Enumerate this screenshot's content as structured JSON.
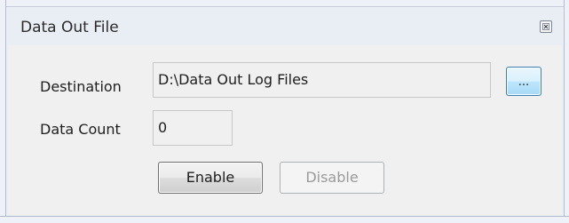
{
  "window": {
    "title": "Data Out File",
    "close_icon": "close-icon"
  },
  "form": {
    "destination_label": "Destination",
    "destination_value": "D:\\Data Out Log Files",
    "browse_label": "...",
    "data_count_label": "Data Count",
    "data_count_value": "0"
  },
  "actions": {
    "enable_label": "Enable",
    "disable_label": "Disable",
    "disable_enabled": false
  },
  "colors": {
    "panel_background": "#e9eef5",
    "browse_accent": "#3c7fb1",
    "disabled_text": "#9a9a9a"
  }
}
